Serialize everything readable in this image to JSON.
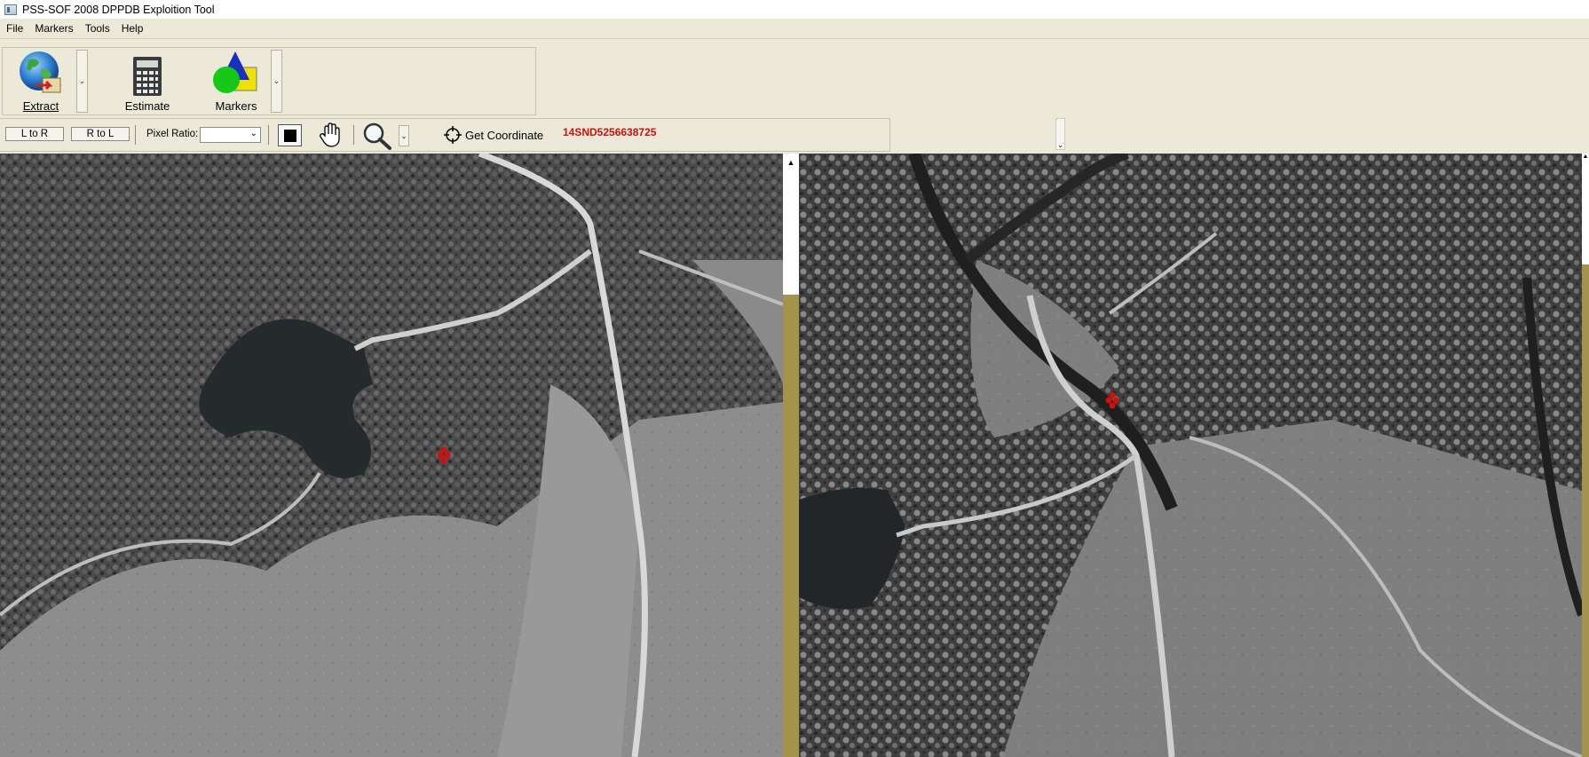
{
  "window": {
    "title": "PSS-SOF 2008 DPPDB Exploition Tool",
    "icon": "app-window-icon"
  },
  "menu": {
    "items": [
      "File",
      "Markers",
      "Tools",
      "Help"
    ]
  },
  "ribbon": {
    "extract": {
      "label": "Extract",
      "icon": "globe-extract-icon"
    },
    "estimate": {
      "label": "Estimate",
      "icon": "calculator-icon"
    },
    "markers": {
      "label": "Markers",
      "icon": "shapes-markers-icon"
    }
  },
  "toolbar": {
    "l_to_r": "L to R",
    "r_to_l": "R to L",
    "pixel_ratio_label": "Pixel Ratio:",
    "pixel_ratio_value": "",
    "get_coordinate_label": "Get Coordinate",
    "coordinate_value": "14SND5256638725",
    "coordinate_color": "#cc1111"
  },
  "images": {
    "left": {
      "description": "aerial-photo-left",
      "marker_color": "#cc1111"
    },
    "right": {
      "description": "aerial-photo-right",
      "marker_color": "#cc1111"
    }
  },
  "scrollbar_color": "#a2944e"
}
